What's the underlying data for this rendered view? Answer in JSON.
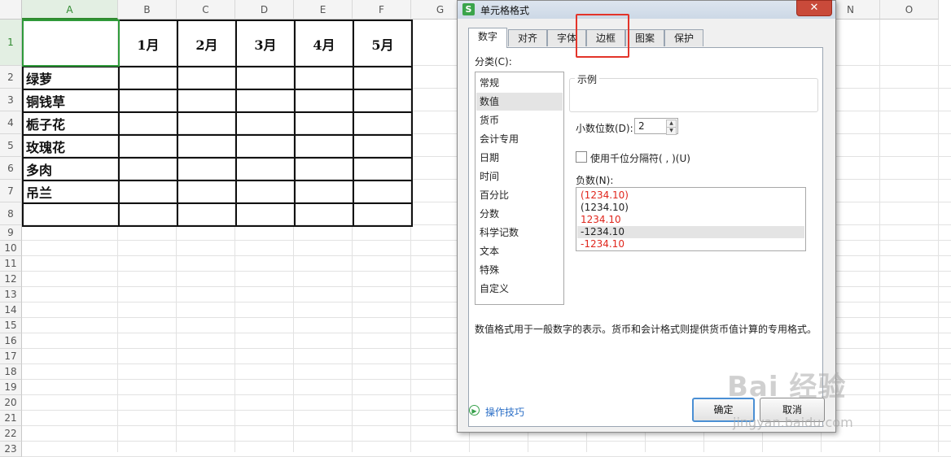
{
  "sheet": {
    "columns": [
      "A",
      "B",
      "C",
      "D",
      "E",
      "F",
      "G",
      "",
      "",
      "",
      "",
      "",
      "",
      "N",
      "O"
    ],
    "rows": [
      "1",
      "2",
      "3",
      "4",
      "5",
      "6",
      "7",
      "8",
      "9",
      "10",
      "11",
      "12",
      "13",
      "14",
      "15",
      "16",
      "17",
      "18",
      "19",
      "20",
      "21",
      "22",
      "23"
    ],
    "header_row": [
      "",
      "1月",
      "2月",
      "3月",
      "4月",
      "5月"
    ],
    "row_labels": [
      "绿萝",
      "铜钱草",
      "栀子花",
      "玫瑰花",
      "多肉",
      "吊兰",
      ""
    ]
  },
  "dialog": {
    "title": "单元格格式",
    "app_icon": "S",
    "close": "✕",
    "tabs": [
      "数字",
      "对齐",
      "字体",
      "边框",
      "图案",
      "保护"
    ],
    "active_tab": "数字",
    "category_label": "分类(C):",
    "categories": [
      "常规",
      "数值",
      "货币",
      "会计专用",
      "日期",
      "时间",
      "百分比",
      "分数",
      "科学记数",
      "文本",
      "特殊",
      "自定义"
    ],
    "selected_category": "数值",
    "sample_label": "示例",
    "decimal_label": "小数位数(D):",
    "decimal_value": "2",
    "thousands_label": "使用千位分隔符( , )(U)",
    "negative_label": "负数(N):",
    "negative_options": [
      "(1234.10)",
      "(1234.10)",
      "1234.10",
      "-1234.10",
      "-1234.10"
    ],
    "negative_colors": [
      "#e0261c",
      "#222222",
      "#e0261c",
      "#222222",
      "#e0261c"
    ],
    "description": "数值格式用于一般数字的表示。货币和会计格式则提供货币值计算的专用格式。",
    "tips": "操作技巧",
    "ok": "确定",
    "cancel": "取消"
  },
  "watermark": {
    "brand": "Bai 经验",
    "url": "jingyan.baidu.com"
  },
  "colors": {
    "selection_green": "#2f9a3a",
    "highlight_red": "#e3342a",
    "link_blue": "#2a6ec6"
  }
}
